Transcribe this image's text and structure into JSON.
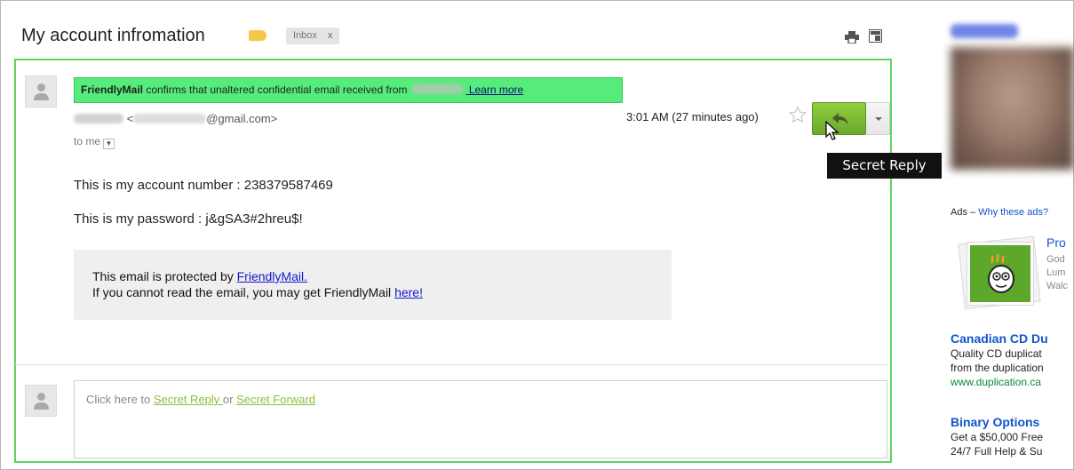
{
  "thread": {
    "subject": "My account infromation",
    "label_chip": "Inbox",
    "label_chip_close": "x",
    "label_color": "#f5c84a"
  },
  "message": {
    "banner": {
      "brand": "FriendlyMail",
      "text": " confirms that unaltered confidential email received from",
      "link": " Learn more"
    },
    "sender": {
      "open_bracket": " <",
      "email_domain": "@gmail.com>"
    },
    "to": "to me",
    "time": "3:01 AM (27 minutes ago)",
    "body": {
      "line1": "This is my account number : 238379587469",
      "line2": "This is my password : j&gSA3#2hreu$!"
    },
    "protection": {
      "line1_prefix": "This email is protected by ",
      "line1_link": "FriendlyMail.",
      "line2_prefix": "If you cannot read the email, you may get FriendlyMail ",
      "line2_link": "here!"
    },
    "tooltip": "Secret Reply"
  },
  "reply_box": {
    "prefix": "Click here to ",
    "secret_reply": "Secret Reply ",
    "or": "or ",
    "secret_forward": "Secret Forward"
  },
  "sidebar": {
    "ads_label": "Ads – ",
    "ads_link": "Why these ads?",
    "ad1": {
      "title": "Pro",
      "line1": "God",
      "line2": "Lum",
      "line3": "Walc"
    },
    "ad2": {
      "title": "Canadian CD Du",
      "line1": "Quality CD duplicat",
      "line2": "from the duplication",
      "url": "www.duplication.ca"
    },
    "ad3": {
      "title": "Binary Options",
      "line1": "Get a $50,000 Free",
      "line2": "24/7 Full Help & Su"
    }
  },
  "icons": {
    "print": "print-icon",
    "new_window": "new-window-icon",
    "star": "star-icon",
    "reply": "reply-arrow-icon",
    "cursor": "mouse-cursor-icon"
  },
  "colors": {
    "message_border": "#5fd35f",
    "banner_bg": "#55ec7c",
    "reply_button": "#7cbb34",
    "link_green": "#8bbf3a"
  }
}
